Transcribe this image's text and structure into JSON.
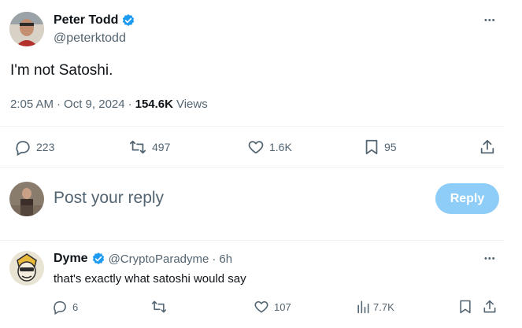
{
  "tweet": {
    "author_name": "Peter Todd",
    "author_handle": "@peterktodd",
    "text": "I'm not Satoshi.",
    "time": "2:05 AM",
    "date": "Oct 9, 2024",
    "separator": "·",
    "views_count": "154.6K",
    "views_label": "Views",
    "more_label": "•••",
    "stats": {
      "replies": "223",
      "reposts": "497",
      "likes": "1.6K",
      "bookmarks": "95"
    }
  },
  "composer": {
    "placeholder": "Post your reply",
    "button_label": "Reply"
  },
  "reply": {
    "author_name": "Dyme",
    "author_handle": "@CryptoParadyme",
    "time_ago": "6h",
    "separator": "·",
    "text": "that's exactly what satoshi would say",
    "more_label": "•••",
    "stats": {
      "replies": "6",
      "likes": "107",
      "views": "7.7K"
    }
  },
  "colors": {
    "verified": "#1d9bf0",
    "muted": "#536471",
    "reply_button": "#8ecdf8",
    "divider": "#eff3f4"
  }
}
